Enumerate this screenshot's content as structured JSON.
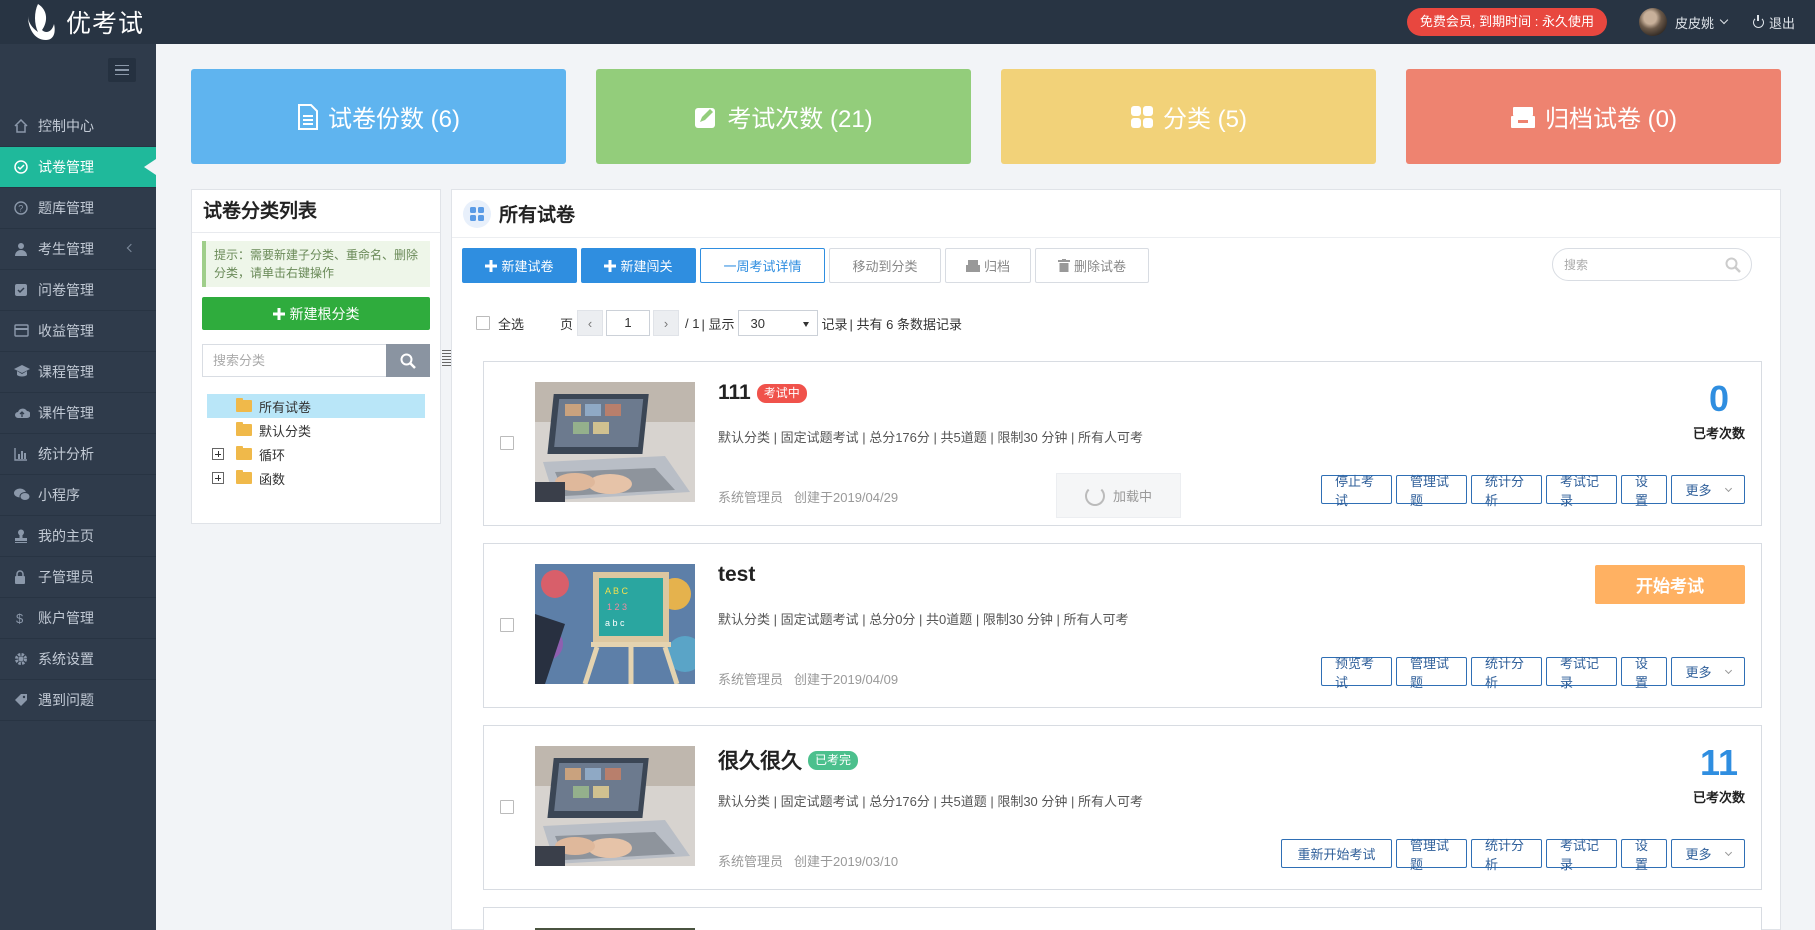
{
  "app": {
    "name": "优考试"
  },
  "header": {
    "vip_text": "免费会员, 到期时间 : 永久使用",
    "user_name": "皮皮姚",
    "logout_label": "退出"
  },
  "sidebar": {
    "items": [
      {
        "label": "控制中心",
        "icon": "home-icon"
      },
      {
        "label": "试卷管理",
        "icon": "check-circle-icon",
        "active": true
      },
      {
        "label": "题库管理",
        "icon": "question-circle-icon"
      },
      {
        "label": "考生管理",
        "icon": "user-icon"
      },
      {
        "label": "问卷管理",
        "icon": "checkbox-icon"
      },
      {
        "label": "收益管理",
        "icon": "credit-card-icon"
      },
      {
        "label": "课程管理",
        "icon": "graduation-cap-icon"
      },
      {
        "label": "课件管理",
        "icon": "cloud-upload-icon"
      },
      {
        "label": "统计分析",
        "icon": "bar-chart-icon"
      },
      {
        "label": "小程序",
        "icon": "wechat-icon"
      },
      {
        "label": "我的主页",
        "icon": "stamp-icon"
      },
      {
        "label": "子管理员",
        "icon": "lock-icon"
      },
      {
        "label": "账户管理",
        "icon": "dollar-icon"
      },
      {
        "label": "系统设置",
        "icon": "gear-icon"
      },
      {
        "label": "遇到问题",
        "icon": "tag-icon"
      }
    ]
  },
  "stats": [
    {
      "label": "试卷份数 (6)",
      "color": "#5fb4ef",
      "icon": "document-icon"
    },
    {
      "label": "考试次数 (21)",
      "color": "#93cd7b",
      "icon": "edit-icon"
    },
    {
      "label": "分类 (5)",
      "color": "#f2d279",
      "icon": "grid-icon"
    },
    {
      "label": "归档试卷 (0)",
      "color": "#ee8370",
      "icon": "archive-icon"
    }
  ],
  "category_panel": {
    "title": "试卷分类列表",
    "tip": "提示：需要新建子分类、重命名、删除分类，请单击右键操作",
    "new_root_label": "新建根分类",
    "search_placeholder": "搜索分类",
    "tree": [
      {
        "label": "所有试卷",
        "selected": true,
        "expandable": false
      },
      {
        "label": "默认分类",
        "selected": false,
        "expandable": false
      },
      {
        "label": "循环",
        "selected": false,
        "expandable": true
      },
      {
        "label": "函数",
        "selected": false,
        "expandable": true
      }
    ]
  },
  "main": {
    "title": "所有试卷",
    "toolbar": {
      "new_exam": "新建试卷",
      "new_level": "新建闯关",
      "week_detail": "一周考试详情",
      "move_category": "移动到分类",
      "archive": "归档",
      "delete": "删除试卷",
      "search_placeholder": "搜索"
    },
    "pager": {
      "select_all": "全选",
      "page_label": "页",
      "current_page": "1",
      "total_pages": "/ 1",
      "show_label": "| 显示",
      "page_size": "30",
      "records_label": "记录",
      "total_text": "| 共有 6 条数据记录"
    },
    "exams": [
      {
        "title": "111",
        "status": "考试中",
        "status_color": "#f0524b",
        "meta": "默认分类 | 固定试题考试 | 总分176分 | 共5道题 | 限制30 分钟 | 所有人可考",
        "author": "系统管理员",
        "created": "创建于2019/04/29",
        "count": "0",
        "count_label": "已考次数",
        "buttons": [
          "停止考试",
          "管理试题",
          "统计分析",
          "考试记录",
          "设置",
          "更多"
        ],
        "loading": "加载中",
        "thumb": "laptop"
      },
      {
        "title": "test",
        "status": "",
        "status_color": "",
        "meta": "默认分类 | 固定试题考试 | 总分0分 | 共0道题 | 限制30 分钟 | 所有人可考",
        "author": "系统管理员",
        "created": "创建于2019/04/09",
        "start_label": "开始考试",
        "buttons": [
          "预览考试",
          "管理试题",
          "统计分析",
          "考试记录",
          "设置",
          "更多"
        ],
        "thumb": "easel"
      },
      {
        "title": "很久很久",
        "status": "已考完",
        "status_color": "#4cc08d",
        "meta": "默认分类 | 固定试题考试 | 总分176分 | 共5道题 | 限制30 分钟 | 所有人可考",
        "author": "系统管理员",
        "created": "创建于2019/03/10",
        "count": "11",
        "count_label": "已考次数",
        "buttons": [
          "重新开始考试",
          "管理试题",
          "统计分析",
          "考试记录",
          "设置",
          "更多"
        ],
        "thumb": "laptop"
      }
    ]
  }
}
